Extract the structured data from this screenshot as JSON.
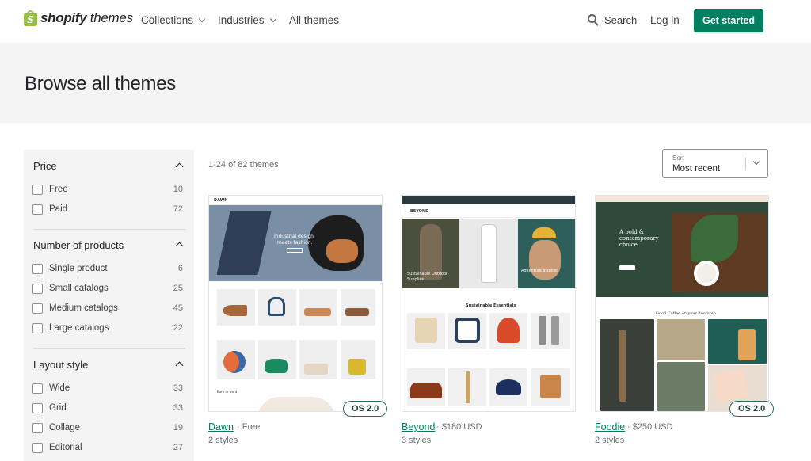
{
  "header": {
    "logo": {
      "brand": "shopify",
      "suffix": "themes"
    },
    "nav": [
      {
        "label": "Collections",
        "dropdown": true
      },
      {
        "label": "Industries",
        "dropdown": true
      },
      {
        "label": "All themes",
        "dropdown": false
      }
    ],
    "search_label": "Search",
    "login_label": "Log in",
    "cta_label": "Get started"
  },
  "hero": {
    "title": "Browse all themes"
  },
  "filters": {
    "price": {
      "title": "Price",
      "options": [
        {
          "label": "Free",
          "count": "10"
        },
        {
          "label": "Paid",
          "count": "72"
        }
      ]
    },
    "products": {
      "title": "Number of products",
      "options": [
        {
          "label": "Single product",
          "count": "6"
        },
        {
          "label": "Small catalogs",
          "count": "25"
        },
        {
          "label": "Medium catalogs",
          "count": "45"
        },
        {
          "label": "Large catalogs",
          "count": "22"
        }
      ]
    },
    "layout": {
      "title": "Layout style",
      "options": [
        {
          "label": "Wide",
          "count": "33"
        },
        {
          "label": "Grid",
          "count": "33"
        },
        {
          "label": "Collage",
          "count": "19"
        },
        {
          "label": "Editorial",
          "count": "27"
        }
      ]
    }
  },
  "results": {
    "count_text": "1-24 of 82 themes"
  },
  "sort": {
    "label": "Sort",
    "value": "Most recent"
  },
  "themes": [
    {
      "name": "Dawn",
      "price": "· Free",
      "styles": "2 styles",
      "badge": "OS 2.0",
      "preview": {
        "logo": "DAWN",
        "headline_1": "Industrial design",
        "headline_2": "meets fashion.",
        "section": "Bare in word"
      }
    },
    {
      "name": "Beyond",
      "price": "· $180 USD",
      "styles": "3 styles",
      "badge": "",
      "preview": {
        "logo": "BEYOND",
        "left_1": "Sustainable Outdoor",
        "left_2": "Supplies",
        "right": "Adventure Inspired",
        "section": "Sustainable Essentials"
      }
    },
    {
      "name": "Foodie",
      "price": "· $250 USD",
      "styles": "2 styles",
      "badge": "OS 2.0",
      "preview": {
        "headline_1": "A bold &",
        "headline_2": "contemporary",
        "headline_3": "choice",
        "section": "Good Coffee on your doorstep"
      }
    }
  ],
  "colors": {
    "accent": "#008060",
    "badge_border": "#2c6e57",
    "sidebar_bg": "#f4f4f4",
    "logo_green": "#95bf47"
  }
}
